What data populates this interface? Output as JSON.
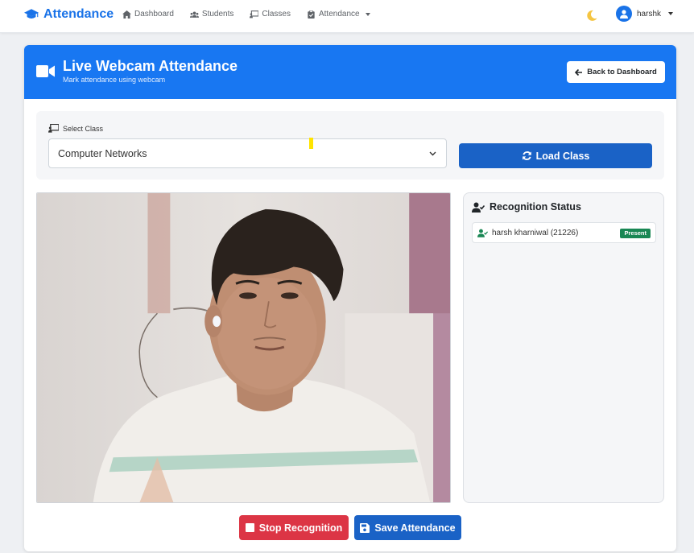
{
  "navbar": {
    "brand": "Attendance",
    "links": [
      {
        "label": "Dashboard",
        "icon": "home-icon"
      },
      {
        "label": "Students",
        "icon": "users-icon"
      },
      {
        "label": "Classes",
        "icon": "chalkboard-icon"
      },
      {
        "label": "Attendance",
        "icon": "clipboard-check-icon",
        "dropdown": true
      }
    ],
    "theme_toggle_icon": "moon-icon",
    "user": {
      "name": "harshk",
      "icon": "user-circle-icon"
    }
  },
  "header": {
    "title": "Live Webcam Attendance",
    "subtitle": "Mark attendance using webcam",
    "back_button": "Back to Dashboard",
    "color": "#1877f2"
  },
  "class_select": {
    "label": "Select Class",
    "selected": "Computer Networks",
    "load_button": "Load Class"
  },
  "webcam": {
    "icon": "video-icon"
  },
  "recognition": {
    "title": "Recognition Status",
    "entries": [
      {
        "name": "harsh kharniwal (21226)",
        "status": "Present",
        "status_color": "#198754"
      }
    ]
  },
  "actions": {
    "stop": "Stop Recognition",
    "save": "Save Attendance",
    "stop_color": "#dc3545",
    "save_color": "#1a62c6"
  }
}
